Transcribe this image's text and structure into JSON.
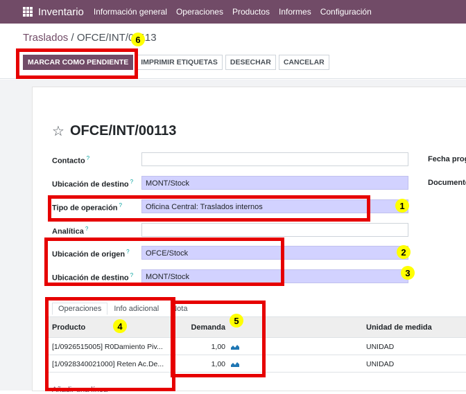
{
  "topbar": {
    "app_name": "Inventario",
    "menu": [
      "Información general",
      "Operaciones",
      "Productos",
      "Informes",
      "Configuración"
    ]
  },
  "breadcrumb": {
    "parent": "Traslados",
    "separator": " / ",
    "current": "OFCE/INT/00113"
  },
  "buttons": {
    "mark_pending": "MARCAR COMO PENDIENTE",
    "print_labels": "IMPRIMIR ETIQUETAS",
    "discard": "DESECHAR",
    "cancel": "CANCELAR"
  },
  "record": {
    "title": "OFCE/INT/00113",
    "fields": {
      "contact": {
        "label": "Contacto",
        "value": ""
      },
      "dest_top": {
        "label": "Ubicación de destino",
        "value": "MONT/Stock"
      },
      "op_type": {
        "label": "Tipo de operación",
        "value": "Oficina Central: Traslados internos"
      },
      "analytic": {
        "label": "Analítica",
        "value": ""
      },
      "origin": {
        "label": "Ubicación de origen",
        "value": "OFCE/Stock"
      },
      "dest": {
        "label": "Ubicación de destino",
        "value": "MONT/Stock"
      }
    },
    "right_labels": {
      "scheduled": "Fecha prog",
      "document": "Documento"
    },
    "help_mark": "?"
  },
  "tabs": [
    "Operaciones",
    "Info adicional",
    "Nota"
  ],
  "table": {
    "headers": {
      "product": "Producto",
      "demand": "Demanda",
      "uom": "Unidad de medida"
    },
    "rows": [
      {
        "product": "[1/0926515005] R0Damiento Piv...",
        "demand": "1,00",
        "uom": "UNIDAD"
      },
      {
        "product": "[1/0928340021000] Reten Ac.De...",
        "demand": "1,00",
        "uom": "UNIDAD"
      }
    ],
    "add_line": "Añadir una línea"
  },
  "annotations": [
    "1",
    "2",
    "3",
    "4",
    "5",
    "6"
  ],
  "colors": {
    "brand": "#714B67",
    "highlight": "#e60000",
    "badge": "#ffff00",
    "required_field": "#d2d2ff"
  }
}
